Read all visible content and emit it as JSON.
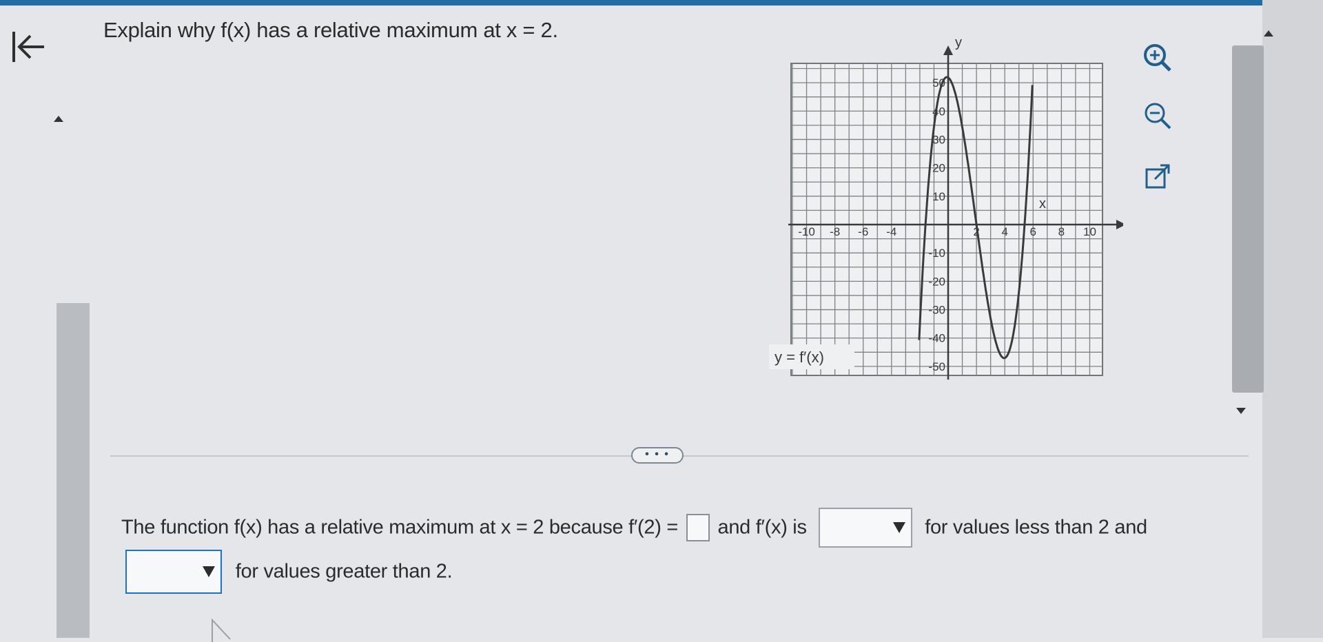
{
  "question": {
    "text": "Explain why f(x) has a relative maximum at x = 2."
  },
  "graph": {
    "axis_x_label": "x",
    "axis_y_label": "y",
    "curve_label": "y = f′(x)",
    "x_tick_labels": [
      "-10",
      "-8",
      "-6",
      "-4",
      "2",
      "4",
      "6",
      "8",
      "10"
    ],
    "y_tick_labels": [
      "50",
      "40",
      "30",
      "20",
      "10",
      "-10",
      "-20",
      "-30",
      "-40",
      "-50"
    ]
  },
  "tools": {
    "zoom_in": "zoom-in-icon",
    "zoom_out": "zoom-out-icon",
    "popout": "popout-icon"
  },
  "more_button": {
    "label": "• • •"
  },
  "answer": {
    "part1": "The function f(x) has a relative maximum at x = 2 because f′(2) =",
    "part2": "and f′(x) is",
    "part3": "for values less than 2 and",
    "part4": "for values greater than 2.",
    "blank_value": "",
    "dropdown1_value": "",
    "dropdown2_value": ""
  }
}
